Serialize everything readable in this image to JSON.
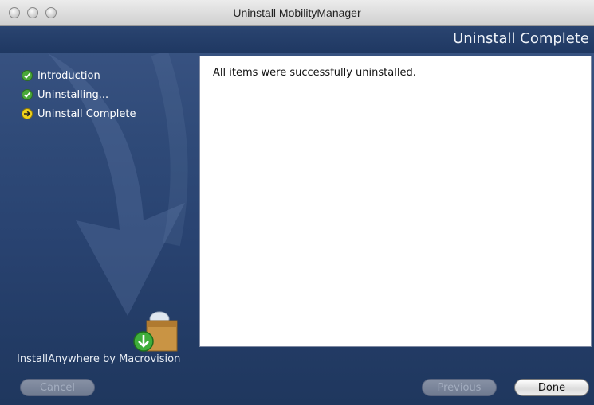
{
  "window": {
    "title": "Uninstall MobilityManager"
  },
  "header": {
    "step_title": "Uninstall Complete"
  },
  "steps": [
    {
      "label": "Introduction",
      "status": "done",
      "icon": "green-check-icon"
    },
    {
      "label": "Uninstalling...",
      "status": "done",
      "icon": "green-check-icon"
    },
    {
      "label": "Uninstall Complete",
      "status": "current",
      "icon": "yellow-arrow-icon"
    }
  ],
  "content": {
    "message": "All items were successfully uninstalled."
  },
  "footer": {
    "brand": "InstallAnywhere by Macrovision"
  },
  "buttons": {
    "cancel": "Cancel",
    "previous": "Previous",
    "done": "Done"
  },
  "colors": {
    "panel_blue": "#2f4a78",
    "check_green": "#4aa83a",
    "arrow_yellow": "#f0d21c"
  }
}
